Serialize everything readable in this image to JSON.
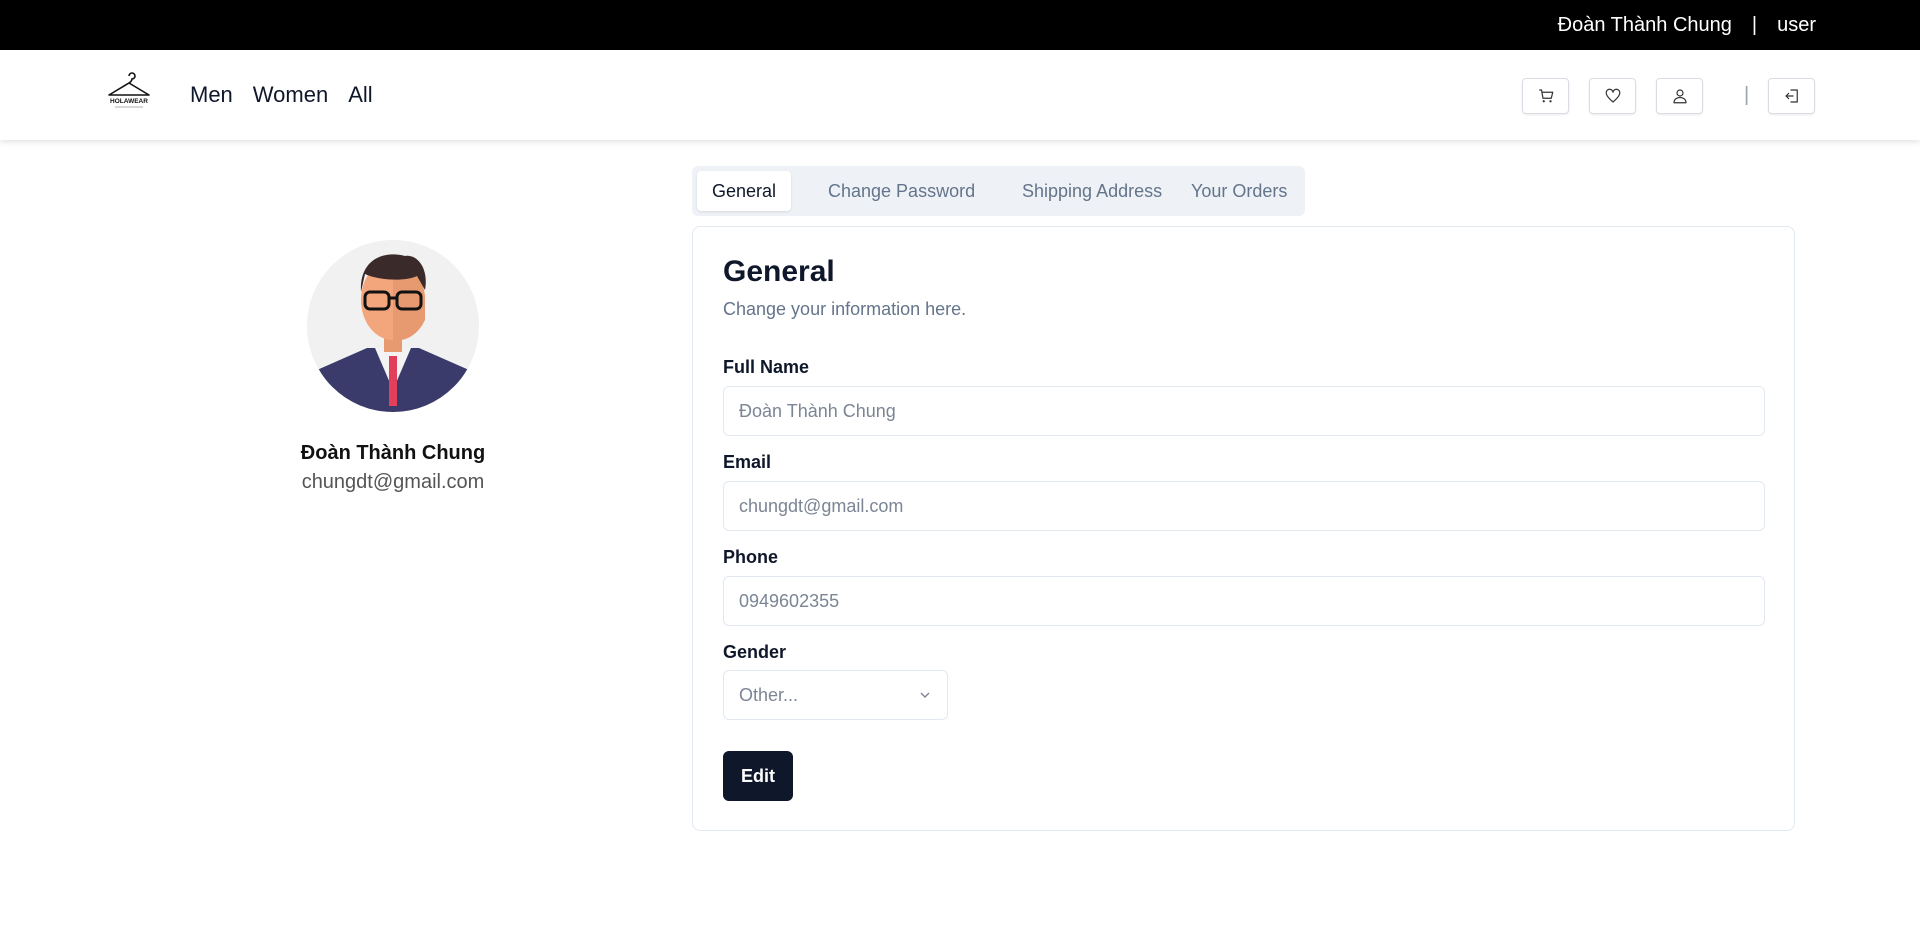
{
  "topbar": {
    "user_name": "Đoàn Thành Chung",
    "separator": "|",
    "role": "user"
  },
  "navbar": {
    "logo_text": "HOLAWEAR",
    "links": [
      "Men",
      "Women",
      "All"
    ],
    "icons": [
      "cart-icon",
      "heart-icon",
      "user-icon",
      "logout-icon"
    ],
    "separator": "|"
  },
  "profile": {
    "name": "Đoàn Thành Chung",
    "email": "chungdt@gmail.com"
  },
  "tabs": [
    {
      "label": "General",
      "active": true
    },
    {
      "label": "Change Password",
      "active": false
    },
    {
      "label": "Shipping Address",
      "active": false
    },
    {
      "label": "Your Orders",
      "active": false
    }
  ],
  "form": {
    "title": "General",
    "description": "Change your information here.",
    "full_name": {
      "label": "Full Name",
      "placeholder": "Đoàn Thành Chung"
    },
    "email": {
      "label": "Email",
      "placeholder": "chungdt@gmail.com"
    },
    "phone": {
      "label": "Phone",
      "placeholder": "0949602355"
    },
    "gender": {
      "label": "Gender",
      "value": "Other..."
    },
    "edit_label": "Edit"
  },
  "colors": {
    "topbar": "#000000",
    "primary_button": "#0f172a",
    "muted_text": "#64748b",
    "border": "#e2e8f0"
  }
}
